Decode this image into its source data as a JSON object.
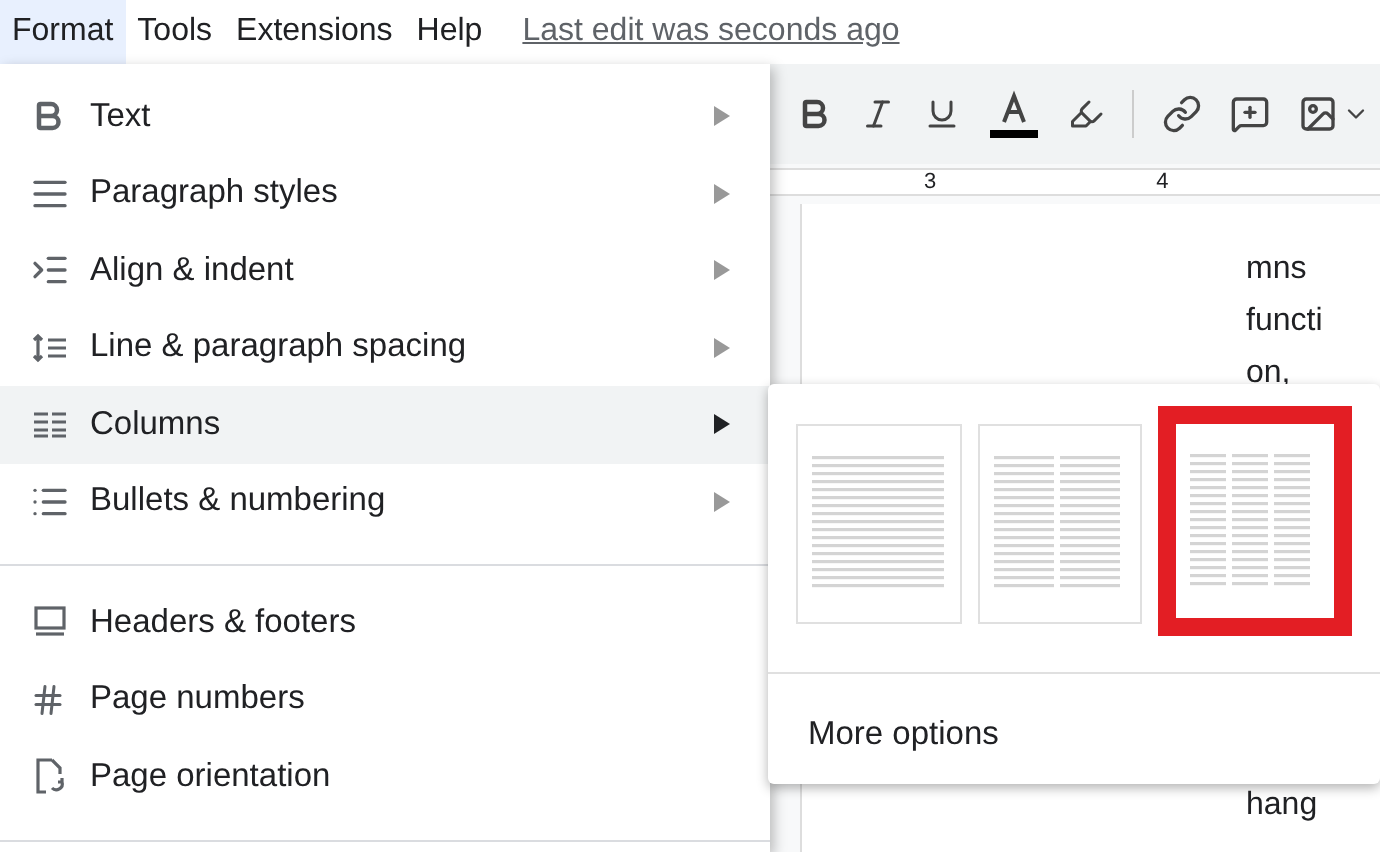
{
  "menu_bar": [
    {
      "label": "Format",
      "selected": true
    },
    {
      "label": "Tools",
      "selected": false
    },
    {
      "label": "Extensions",
      "selected": false
    },
    {
      "label": "Help",
      "selected": false
    }
  ],
  "last_edit": "Last edit was seconds ago",
  "ruler": {
    "marks": [
      "3",
      "4"
    ]
  },
  "format_menu": {
    "groups": [
      [
        {
          "label": "Text",
          "submenu": true,
          "selected": false
        },
        {
          "label": "Paragraph styles",
          "submenu": true,
          "selected": false
        },
        {
          "label": "Align & indent",
          "submenu": true,
          "selected": false
        },
        {
          "label": "Line & paragraph spacing",
          "submenu": true,
          "selected": false
        },
        {
          "label": "Columns",
          "submenu": true,
          "selected": true
        },
        {
          "label": "Bullets & numbering",
          "submenu": true,
          "selected": false
        }
      ],
      [
        {
          "label": "Headers & footers",
          "submenu": false,
          "selected": false
        },
        {
          "label": "Page numbers",
          "submenu": false,
          "selected": false
        },
        {
          "label": "Page orientation",
          "submenu": false,
          "selected": false
        }
      ]
    ]
  },
  "columns_submenu": {
    "options": [
      {
        "kind": "single",
        "selected": false
      },
      {
        "kind": "double",
        "selected": false
      },
      {
        "kind": "triple",
        "selected": true
      }
    ],
    "more": "More options"
  },
  "document_text": [
    "mns",
    "functi",
    "on,",
    "hang"
  ]
}
